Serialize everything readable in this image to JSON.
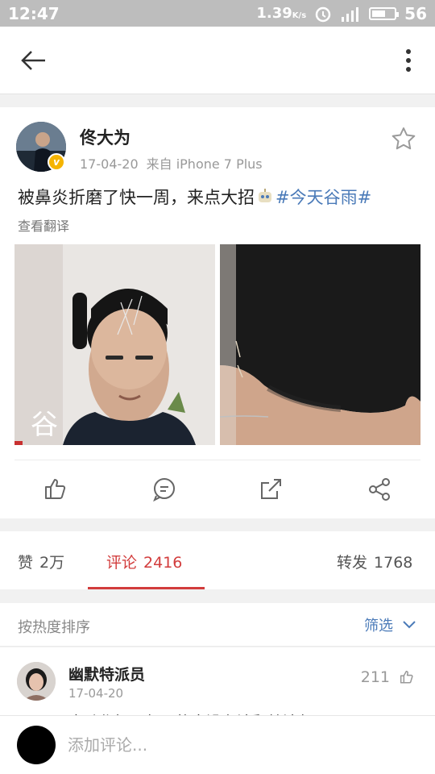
{
  "status_bar": {
    "time": "12:47",
    "speed_value": "1.39",
    "speed_unit": "K/s",
    "battery": "56"
  },
  "header": {
    "back_icon": "arrow-left-icon",
    "more_icon": "more-vertical-icon"
  },
  "post": {
    "author": "佟大为",
    "date": "17-04-20",
    "source": "来自 iPhone 7 Plus",
    "text": "被鼻炎折磨了快一周，来点大招",
    "emoji": "robot-emoji",
    "hashtag": "#今天谷雨#",
    "translate": "查看翻译",
    "verified_color": "#f5b400",
    "images": [
      "face-photo-acupuncture",
      "neck-photo-acupuncture"
    ],
    "photo_overlay_text": "谷",
    "actions": [
      "like-icon",
      "comment-icon",
      "forward-icon",
      "share-icon"
    ]
  },
  "tabs": {
    "likes": {
      "label": "赞",
      "count": "2万"
    },
    "comments": {
      "label": "评论",
      "count": "2416"
    },
    "reposts": {
      "label": "转发",
      "count": "1768"
    },
    "active_color": "#d23c3c"
  },
  "sort": {
    "label": "按热度排序",
    "filter": "筛选"
  },
  "comments": [
    {
      "name": "幽默特派员",
      "date": "17-04-20",
      "likes": "211",
      "preview": "事动作好几年了的来没有法翻特法年了"
    }
  ],
  "input": {
    "placeholder": "添加评论..."
  },
  "accent": "#4a7ab8"
}
